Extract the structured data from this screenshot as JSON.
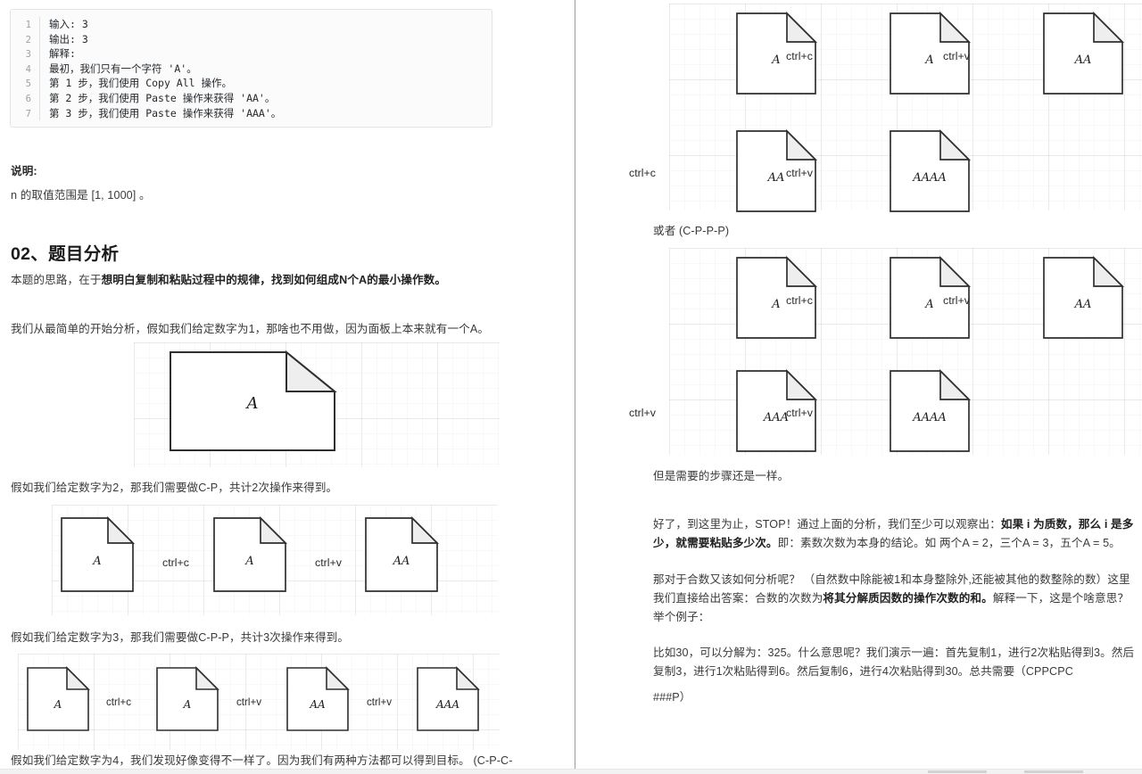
{
  "code_block": {
    "lines": [
      {
        "n": "1",
        "text": "输入: 3"
      },
      {
        "n": "2",
        "text": "输出: 3"
      },
      {
        "n": "3",
        "text": "解释:"
      },
      {
        "n": "4",
        "text": "最初，我们只有一个字符 'A'。"
      },
      {
        "n": "5",
        "text": "第 1 步，我们使用 Copy All 操作。"
      },
      {
        "n": "6",
        "text": "第 2 步，我们使用 Paste 操作来获得 'AA'。"
      },
      {
        "n": "7",
        "text": "第 3 步，我们使用 Paste 操作来获得 'AAA'。"
      }
    ]
  },
  "left": {
    "note_title": "说明:",
    "note_body": "n 的取值范围是 [1, 1000] 。",
    "heading": "02、题目分析",
    "intro_plain": "本题的思路，在于",
    "intro_bold": "想明白复制和粘贴过程中的规律，找到如何组成N个A的最小操作数。",
    "para_n1": "我们从最简单的开始分析，假如我们给定数字为1，那啥也不用做，因为面板上本来就有一个A。",
    "para_n2": "假如我们给定数字为2，那我们需要做C-P，共计2次操作来得到。",
    "para_n3": "假如我们给定数字为3，那我们需要做C-P-P，共计3次操作来得到。",
    "para_n4": "假如我们给定数字为4，我们发现好像变得不一样了。因为我们有两种方法都可以得到目标。 (C-P-C-",
    "diagram_single": {
      "label": "A"
    },
    "diagram_n2": {
      "docs": [
        "A",
        "A",
        "AA"
      ],
      "ops": [
        "ctrl+c",
        "ctrl+v"
      ]
    },
    "diagram_n3": {
      "docs": [
        "A",
        "A",
        "AA",
        "AAA"
      ],
      "ops": [
        "ctrl+c",
        "ctrl+v",
        "ctrl+v"
      ]
    }
  },
  "right": {
    "diagram_cpcp": {
      "row1_docs": [
        "A",
        "A",
        "AA"
      ],
      "row1_ops": [
        "ctrl+c",
        "ctrl+v"
      ],
      "row2_docs": [
        "AA",
        "AAAA"
      ],
      "row2_ops": [
        "ctrl+c",
        "ctrl+v"
      ]
    },
    "caption_or": "或者 (C-P-P-P)",
    "diagram_cppp": {
      "row1_docs": [
        "A",
        "A",
        "AA"
      ],
      "row1_ops": [
        "ctrl+c",
        "ctrl+v"
      ],
      "row2_docs": [
        "AAA",
        "AAAA"
      ],
      "row2_ops": [
        "ctrl+v",
        "ctrl+v"
      ]
    },
    "caption_same": "但是需要的步骤还是一样。",
    "para_prime_a": "好了，到这里为止，STOP！通过上面的分析，我们至少可以观察出：",
    "para_prime_b": "如果 i 为质数，那么 i 是多少，就需要粘贴多少次。",
    "para_prime_c": "即：素数次数为本身的结论。如 两个A = 2，三个A = 3，五个A = 5。",
    "para_comp_a": "那对于合数又该如何分析呢？ （自然数中除能被1和本身整除外,还能被其他的数整除的数）这里我们直接给出答案：合数的次数为",
    "para_comp_b": "将其分解质因数的操作次数的和。",
    "para_comp_c": "解释一下，这是个啥意思？ 举个例子：",
    "para_example": "比如30，可以分解为：325。什么意思呢？我们演示一遍：首先复制1，进行2次粘贴得到3。然后复制3，进行1次粘贴得到6。然后复制6，进行4次粘贴得到30。总共需要（CPPCPC",
    "para_example_tail": "###P）"
  }
}
